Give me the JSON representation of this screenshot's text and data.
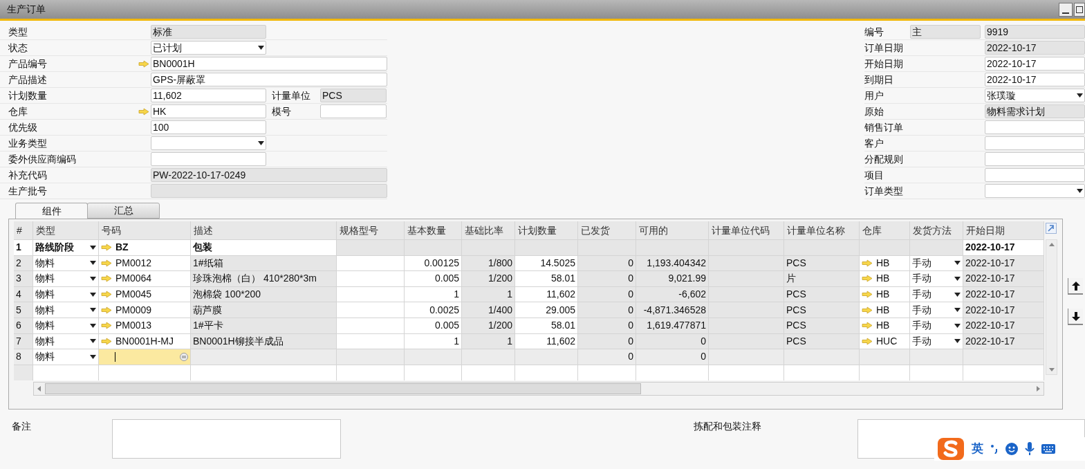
{
  "window": {
    "title": "生产订单"
  },
  "header_left": [
    {
      "label": "类型",
      "value": "标准",
      "kind": "readonly",
      "wide": false
    },
    {
      "label": "状态",
      "value": "已计划",
      "kind": "dropdown",
      "wide": false
    },
    {
      "label": "产品编号",
      "value": "BN0001H",
      "kind": "link",
      "wide": true
    },
    {
      "label": "产品描述",
      "value": "GPS-屏蔽罩",
      "kind": "text",
      "wide": true
    },
    {
      "label": "计划数量",
      "value": "11,602",
      "kind": "text",
      "wide": false,
      "extra": {
        "label": "计量单位",
        "value": "PCS",
        "kind": "readonly"
      }
    },
    {
      "label": "仓库",
      "value": "HK",
      "kind": "link",
      "wide": false,
      "extra": {
        "label": "模号",
        "kind": "text"
      }
    },
    {
      "label": "优先级",
      "value": "100",
      "kind": "text",
      "wide": false
    },
    {
      "label": "业务类型",
      "kind": "dropdown",
      "wide": false
    },
    {
      "label": "委外供应商编码",
      "kind": "text",
      "wide": false
    },
    {
      "label": "补充代码",
      "value": "PW-2022-10-17-0249",
      "kind": "readonly",
      "wide": true
    },
    {
      "label": "生产批号",
      "kind": "readonly",
      "wide": true
    }
  ],
  "header_right": [
    {
      "label": "编号",
      "prefix": "主",
      "value": "9919",
      "kind": "readonly"
    },
    {
      "label": "订单日期",
      "value": "2022-10-17",
      "kind": "readonly"
    },
    {
      "label": "开始日期",
      "value": "2022-10-17",
      "kind": "text"
    },
    {
      "label": "到期日",
      "value": "2022-10-17",
      "kind": "text"
    },
    {
      "label": "用户",
      "value": "张璞璇",
      "kind": "dropdown"
    },
    {
      "label": "原始",
      "value": "物料需求计划",
      "kind": "readonly"
    },
    {
      "label": "销售订单",
      "kind": "text"
    },
    {
      "label": "客户",
      "kind": "text"
    },
    {
      "label": "分配规则",
      "kind": "text"
    },
    {
      "label": "项目",
      "kind": "text"
    },
    {
      "label": "订单类型",
      "kind": "dropdown"
    }
  ],
  "tabs": [
    {
      "label": "组件",
      "selected": true
    },
    {
      "label": "汇总",
      "selected": false
    }
  ],
  "table": {
    "columns": [
      {
        "label": "#",
        "shaded": true
      },
      {
        "label": "类型",
        "shaded": false,
        "dropdown": true
      },
      {
        "label": "号码",
        "shaded": false,
        "link": true
      },
      {
        "label": "描述",
        "shaded": true
      },
      {
        "label": "规格型号",
        "shaded": false
      },
      {
        "label": "基本数量",
        "shaded": false,
        "numeric": true
      },
      {
        "label": "基础比率",
        "shaded": true,
        "numeric": true
      },
      {
        "label": "计划数量",
        "shaded": false,
        "numeric": true
      },
      {
        "label": "已发货",
        "shaded": true,
        "numeric": true
      },
      {
        "label": "可用的",
        "shaded": true,
        "numeric": true
      },
      {
        "label": "计量单位代码",
        "shaded": true
      },
      {
        "label": "计量单位名称",
        "shaded": true
      },
      {
        "label": "仓库",
        "shaded": false,
        "link": true
      },
      {
        "label": "发货方法",
        "shaded": false,
        "dropdown": true
      },
      {
        "label": "开始日期",
        "shaded": true
      }
    ],
    "rows": [
      {
        "kind": "stage",
        "cells": [
          "1",
          "路线阶段",
          "BZ",
          "包装",
          "",
          "",
          "",
          "",
          "",
          "",
          "",
          "",
          "",
          "",
          "2022-10-17"
        ]
      },
      {
        "kind": "item",
        "cells": [
          "2",
          "物料",
          "PM0012",
          "1#纸箱",
          "",
          "0.00125",
          "1/800",
          "14.5025",
          "0",
          "1,193.404342",
          "",
          "PCS",
          "HB",
          "手动",
          "2022-10-17"
        ]
      },
      {
        "kind": "item",
        "cells": [
          "3",
          "物料",
          "PM0064",
          "珍珠泡棉（白）  410*280*3m",
          "",
          "0.005",
          "1/200",
          "58.01",
          "0",
          "9,021.99",
          "",
          "片",
          "HB",
          "手动",
          "2022-10-17"
        ]
      },
      {
        "kind": "item",
        "cells": [
          "4",
          "物料",
          "PM0045",
          "泡棉袋  100*200",
          "",
          "1",
          "1",
          "11,602",
          "0",
          "-6,602",
          "",
          "PCS",
          "HB",
          "手动",
          "2022-10-17"
        ]
      },
      {
        "kind": "item",
        "cells": [
          "5",
          "物料",
          "PM0009",
          "葫芦膜",
          "",
          "0.0025",
          "1/400",
          "29.005",
          "0",
          "-4,871.346528",
          "",
          "PCS",
          "HB",
          "手动",
          "2022-10-17"
        ]
      },
      {
        "kind": "item",
        "cells": [
          "6",
          "物料",
          "PM0013",
          "1#平卡",
          "",
          "0.005",
          "1/200",
          "58.01",
          "0",
          "1,619.477871",
          "",
          "PCS",
          "HB",
          "手动",
          "2022-10-17"
        ]
      },
      {
        "kind": "item",
        "cells": [
          "7",
          "物料",
          "BN0001H-MJ",
          "BN0001H铆接半成品",
          "",
          "1",
          "1",
          "11,602",
          "0",
          "0",
          "",
          "PCS",
          "HUC",
          "手动",
          "2022-10-17"
        ]
      },
      {
        "kind": "new",
        "cells": [
          "8",
          "物料",
          "",
          "",
          "",
          "",
          "",
          "",
          "0",
          "0",
          "",
          "",
          "",
          "",
          ""
        ]
      }
    ]
  },
  "footer": [
    {
      "label": "备注"
    },
    {
      "label": "拣配和包装注释"
    }
  ],
  "ime": {
    "mode": "英"
  }
}
